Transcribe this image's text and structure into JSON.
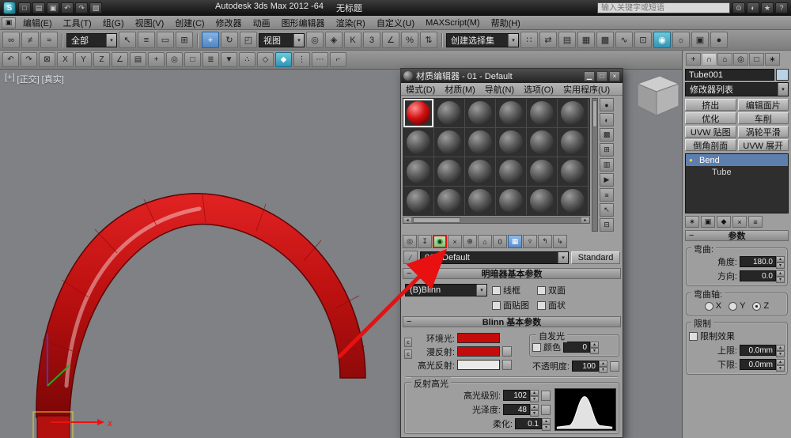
{
  "ui": {
    "minus": "−",
    "chev": "▾",
    "lock": "c",
    "pick": "∕"
  },
  "titlebar": {
    "app_title": "Autodesk 3ds Max 2012 -64",
    "doc_title": "无标题",
    "search_placeholder": "输入关键字或短语",
    "logo_glyph": "S",
    "qat_icons": [
      {
        "name": "new-scene-icon",
        "glyph": "□"
      },
      {
        "name": "open-file-icon",
        "glyph": "▤"
      },
      {
        "name": "save-file-icon",
        "glyph": "▣"
      },
      {
        "name": "undo-icon",
        "glyph": "↶"
      },
      {
        "name": "redo-icon",
        "glyph": "↷"
      },
      {
        "name": "project-folder-icon",
        "glyph": "▧"
      }
    ],
    "info_icons": [
      {
        "name": "search-go-icon",
        "glyph": "⊙"
      },
      {
        "name": "communication-center-icon",
        "glyph": "◐"
      },
      {
        "name": "favorites-icon",
        "glyph": "★"
      },
      {
        "name": "help-icon",
        "glyph": "?"
      }
    ]
  },
  "menubar": {
    "icon": "▣",
    "items": [
      "编辑(E)",
      "工具(T)",
      "组(G)",
      "视图(V)",
      "创建(C)",
      "修改器",
      "动画",
      "图形编辑器",
      "渲染(R)",
      "自定义(U)",
      "MAXScript(M)",
      "帮助(H)"
    ]
  },
  "toolbar1": {
    "filter_dd": "全部",
    "refcoord_dd": "视图",
    "namedsel_dd": "创建选择集",
    "link_icons": [
      {
        "name": "select-and-link-icon",
        "glyph": "∞"
      },
      {
        "name": "unlink-selection-icon",
        "glyph": "≠"
      },
      {
        "name": "bind-to-space-warp-icon",
        "glyph": "≈"
      }
    ],
    "select_icons": [
      {
        "name": "select-object-icon",
        "glyph": "↖"
      },
      {
        "name": "select-by-name-icon",
        "glyph": "≡"
      },
      {
        "name": "rectangular-selection-region-icon",
        "glyph": "▭"
      },
      {
        "name": "window-crossing-icon",
        "glyph": "⊞"
      }
    ],
    "transform_icons": [
      {
        "name": "select-and-move-icon",
        "glyph": "+",
        "cls": "active"
      },
      {
        "name": "select-and-rotate-icon",
        "glyph": "↻"
      },
      {
        "name": "select-and-scale-icon",
        "glyph": "◰"
      }
    ],
    "snap_icons": [
      {
        "name": "use-pivot-center-icon",
        "glyph": "◎"
      },
      {
        "name": "select-and-manipulate-icon",
        "glyph": "◈"
      },
      {
        "name": "keyboard-shortcut-override-icon",
        "glyph": "K"
      },
      {
        "name": "snaps-toggle-icon",
        "glyph": "3"
      },
      {
        "name": "angle-snap-icon",
        "glyph": "∠"
      },
      {
        "name": "percent-snap-icon",
        "glyph": "%"
      },
      {
        "name": "spinner-snap-icon",
        "glyph": "⇅"
      }
    ],
    "right_icons": [
      {
        "name": "edit-named-selection-icon",
        "glyph": "∷"
      },
      {
        "name": "mirror-icon",
        "glyph": "⇄"
      },
      {
        "name": "align-icon",
        "glyph": "▤"
      },
      {
        "name": "layer-manager-icon",
        "glyph": "▦"
      },
      {
        "name": "graphite-ribbon-icon",
        "glyph": "▩"
      },
      {
        "name": "curve-editor-icon",
        "glyph": "∿"
      },
      {
        "name": "schematic-view-icon",
        "glyph": "⊡"
      },
      {
        "name": "material-editor-icon",
        "glyph": "◉",
        "cls": "active-teal"
      },
      {
        "name": "render-setup-icon",
        "glyph": "☼"
      },
      {
        "name": "rendered-frame-window-icon",
        "glyph": "▣"
      },
      {
        "name": "render-production-icon",
        "glyph": "●"
      }
    ]
  },
  "toolbar2": {
    "icons": [
      {
        "name": "undo-view-icon",
        "glyph": "↶"
      },
      {
        "name": "redo-view-icon",
        "glyph": "↷"
      },
      {
        "name": "selection-lock-icon",
        "glyph": "⊠"
      },
      {
        "name": "axis-constraint-x-icon",
        "glyph": "X"
      },
      {
        "name": "axis-constraint-y-icon",
        "glyph": "Y"
      },
      {
        "name": "axis-constraint-z-icon",
        "glyph": "Z"
      },
      {
        "name": "axis-constraint-plane-icon",
        "glyph": "∠"
      },
      {
        "name": "layer-list-icon",
        "glyph": "▤"
      },
      {
        "name": "create-new-layer-icon",
        "glyph": "+"
      },
      {
        "name": "isolate-selection-icon",
        "glyph": "◎"
      },
      {
        "name": "display-floater-icon",
        "glyph": "□"
      },
      {
        "name": "scene-explorer-icon",
        "glyph": "≣"
      },
      {
        "name": "ribbon-toggle-icon",
        "glyph": "▼"
      },
      {
        "name": "snap-extras-icon",
        "glyph": "∴"
      },
      {
        "name": "polygon-counter-icon",
        "glyph": "◇"
      },
      {
        "name": "graphite-tools-icon",
        "glyph": "◆",
        "cls": "active-teal"
      },
      {
        "name": "array-tool-icon",
        "glyph": "⋮"
      },
      {
        "name": "spacing-tool-icon",
        "glyph": "⋯"
      },
      {
        "name": "measure-distance-icon",
        "glyph": "⌐"
      }
    ]
  },
  "viewport": {
    "label_plus": "[+]",
    "label_view": "[正交]",
    "label_shading": "[真实]",
    "axis_label": "x"
  },
  "material_editor": {
    "title": "材质编辑器 - 01 - Default",
    "window_buttons": [
      {
        "name": "minimize-button",
        "glyph": "▁"
      },
      {
        "name": "maximize-button",
        "glyph": "□"
      },
      {
        "name": "close-button",
        "glyph": "×"
      }
    ],
    "menu": [
      "模式(D)",
      "材质(M)",
      "导航(N)",
      "选项(O)",
      "实用程序(U)"
    ],
    "slots": [
      "red active",
      "",
      "",
      "",
      "",
      "",
      "",
      "",
      "",
      "",
      "",
      "",
      "",
      "",
      "",
      "",
      "",
      "",
      "",
      "",
      "",
      "",
      "",
      ""
    ],
    "side_icons": [
      {
        "name": "sample-type-sphere-icon",
        "glyph": "●"
      },
      {
        "name": "backlight-icon",
        "glyph": "◐"
      },
      {
        "name": "background-icon",
        "glyph": "▩"
      },
      {
        "name": "sample-uv-tiling-icon",
        "glyph": "⊞"
      },
      {
        "name": "video-color-check-icon",
        "glyph": "▥"
      },
      {
        "name": "make-preview-icon",
        "glyph": "▶"
      },
      {
        "name": "options-icon",
        "glyph": "≡"
      },
      {
        "name": "select-by-material-icon",
        "glyph": "↖"
      },
      {
        "name": "material-map-navigator-icon",
        "glyph": "⊟"
      }
    ],
    "bottom_icons": [
      {
        "name": "get-material-icon",
        "glyph": "◎"
      },
      {
        "name": "put-material-to-scene-icon",
        "glyph": "↧"
      },
      {
        "name": "assign-material-to-selection-icon",
        "glyph": "◉",
        "cls": "assign"
      },
      {
        "name": "reset-map-icon",
        "glyph": "×"
      },
      {
        "name": "make-material-copy-icon",
        "glyph": "⊕"
      },
      {
        "name": "put-to-library-icon",
        "glyph": "⌂"
      },
      {
        "name": "material-id-channel-icon",
        "glyph": "0"
      },
      {
        "name": "show-shaded-material-in-viewport-icon",
        "glyph": "▦",
        "cls": "active-blue"
      },
      {
        "name": "show-end-result-icon",
        "glyph": "▿"
      },
      {
        "name": "go-to-parent-icon",
        "glyph": "↰"
      },
      {
        "name": "go-forward-to-sibling-icon",
        "glyph": "↳"
      }
    ],
    "material_name": "01 - Default",
    "type_button": "Standard",
    "rollout_shader": "明暗器基本参数",
    "shader_type": "(B)Blinn",
    "cb_wireframe": "线框",
    "cb_twosided": "双面",
    "cb_facemap": "面贴图",
    "cb_faceted": "面状",
    "rollout_blinn": "Blinn 基本参数",
    "ambient_label": "环境光:",
    "diffuse_label": "漫反射:",
    "specular_label": "高光反射:",
    "ambient_color": "#c50c0c",
    "diffuse_color": "#c50c0c",
    "specular_color": "#e9e9e9",
    "selfillum_group": "自发光",
    "color_cb": "颜色",
    "color_value": "0",
    "opacity_label": "不透明度:",
    "opacity_value": "100",
    "highlights_group": "反射高光",
    "spec_level_label": "高光级别:",
    "spec_level_value": "102",
    "gloss_label": "光泽度:",
    "gloss_value": "48",
    "soften_label": "柔化:",
    "soften_value": "0.1"
  },
  "command_panel": {
    "tabs": [
      {
        "name": "tab-create",
        "glyph": "+"
      },
      {
        "name": "tab-modify",
        "glyph": "∩",
        "cls": "active"
      },
      {
        "name": "tab-hierarchy",
        "glyph": "⌂"
      },
      {
        "name": "tab-motion",
        "glyph": "◎"
      },
      {
        "name": "tab-display",
        "glyph": "□"
      },
      {
        "name": "tab-utilities",
        "glyph": "∗"
      }
    ],
    "object_name": "Tube001",
    "object_color": "#b9d2e6",
    "modifier_list_label": "修改器列表",
    "modifier_buttons": [
      "挤出",
      "编辑面片",
      "优化",
      "车削",
      "UVW 贴图",
      "涡轮平滑",
      "倒角剖面",
      "UVW 展开"
    ],
    "stack": [
      {
        "bulb": "●",
        "label": "Bend",
        "cls": "selected"
      },
      {
        "bulb": "",
        "label": "Tube",
        "cls": "child"
      }
    ],
    "stack_icons": [
      {
        "name": "pin-stack-icon",
        "glyph": "∗"
      },
      {
        "name": "show-end-result-stack-icon",
        "glyph": "▣"
      },
      {
        "name": "make-unique-icon",
        "glyph": "◆"
      },
      {
        "name": "remove-modifier-icon",
        "glyph": "×"
      },
      {
        "name": "configure-modifier-sets-icon",
        "glyph": "≡"
      }
    ],
    "rollout_params": "参数",
    "group_bend": "弯曲:",
    "angle_label": "角度:",
    "angle_value": "180.0",
    "dir_label": "方向:",
    "dir_value": "0.0",
    "group_axis": "弯曲轴:",
    "axis_x": "X",
    "axis_y": "Y",
    "axis_z": "Z",
    "group_limits": "限制",
    "limit_cb": "限制效果",
    "upper_label": "上限:",
    "upper_value": "0.0mm",
    "lower_label": "下限:",
    "lower_value": "0.0mm"
  },
  "colors": {
    "tube_red": "#c40b0b",
    "annotation_red": "#e81010",
    "gizmo_yellow": "#e3cf3a"
  }
}
